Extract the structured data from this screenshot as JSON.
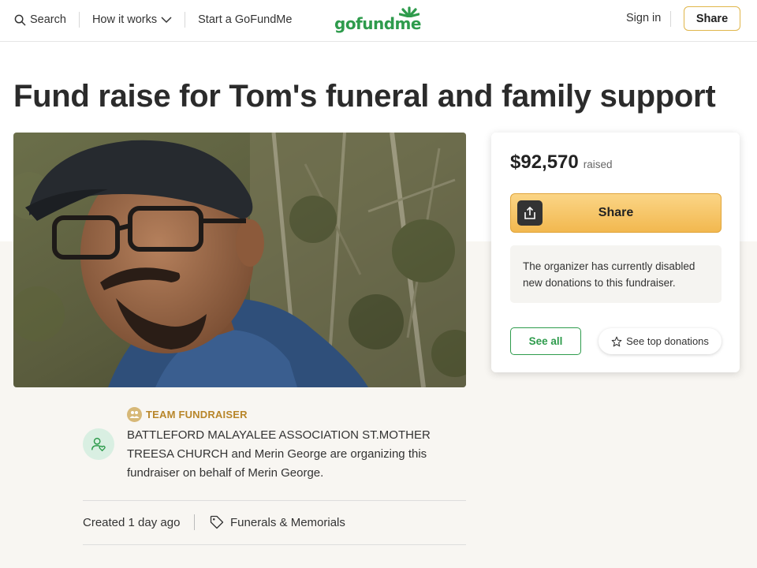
{
  "header": {
    "search_label": "Search",
    "how_it_works_label": "How it works",
    "start_label": "Start a GoFundMe",
    "logo_text": "gofundme",
    "sign_in_label": "Sign in",
    "share_label": "Share"
  },
  "campaign": {
    "title": "Fund raise for Tom's funeral and family support",
    "photo_subject": "Man with glasses and cap in front of trees"
  },
  "donation_card": {
    "amount": "$92,570",
    "raised_label": "raised",
    "share_label": "Share",
    "disabled_note": "The organizer has currently disabled new donations to this fundraiser.",
    "see_all_label": "See all",
    "see_top_label": "See top donations"
  },
  "organizer": {
    "team_label": "TEAM FUNDRAISER",
    "description": "BATTLEFORD MALAYALEE ASSOCIATION ST.MOTHER TREESA CHURCH and Merin George are organizing this fundraiser on behalf of Merin George."
  },
  "meta": {
    "created": "Created 1 day ago",
    "category": "Funerals & Memorials"
  },
  "colors": {
    "brand_green": "#2e9b4c",
    "share_gold": "#f2b84f",
    "team_gold": "#b8862a"
  }
}
